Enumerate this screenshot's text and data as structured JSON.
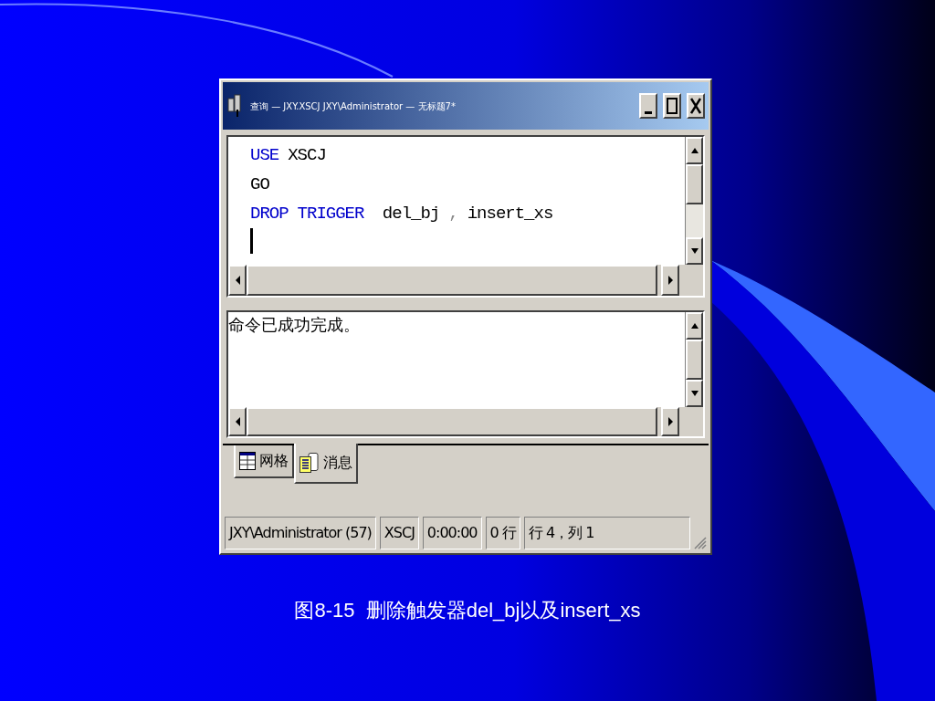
{
  "window": {
    "title": "查询 — JXY.XSCJ JXY\\Administrator — 无标题7*"
  },
  "editor": {
    "lines": [
      [
        {
          "kind": "keyword",
          "text": "USE"
        },
        {
          "kind": "plain",
          "text": "XSCJ"
        }
      ],
      [
        {
          "kind": "plain",
          "text": "GO"
        }
      ],
      [
        {
          "kind": "keyword",
          "text": "DROP"
        },
        {
          "kind": "keyword",
          "text": "TRIGGER"
        },
        {
          "kind": "plain",
          "text": " del_bj"
        },
        {
          "kind": "punct",
          "text": ","
        },
        {
          "kind": "plain",
          "text": "insert_xs"
        }
      ]
    ]
  },
  "results": {
    "message": "命令已成功完成。"
  },
  "tabs": [
    {
      "label": "网格",
      "kind": "grid",
      "selected": false
    },
    {
      "label": "消息",
      "kind": "messages",
      "selected": true
    }
  ],
  "status_bar": [
    "JXY\\Administrator (57)",
    "XSCJ",
    "0:00:00",
    "0 行",
    "行 4，列 1"
  ],
  "caption": "图8-15  删除触发器del_bj以及insert_xs"
}
